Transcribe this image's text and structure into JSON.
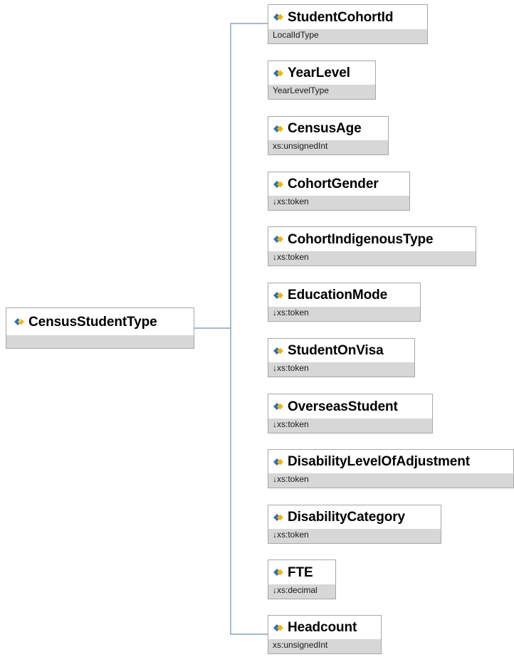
{
  "diagram": {
    "root": {
      "name": "CensusStudentType",
      "type": ""
    },
    "elements": [
      {
        "name": "StudentCohortId",
        "type": "LocalIdType"
      },
      {
        "name": "YearLevel",
        "type": "YearLevelType"
      },
      {
        "name": "CensusAge",
        "type": "xs:unsignedInt"
      },
      {
        "name": "CohortGender",
        "type": "↓xs:token"
      },
      {
        "name": "CohortIndigenousType",
        "type": "↓xs:token"
      },
      {
        "name": "EducationMode",
        "type": "↓xs:token"
      },
      {
        "name": "StudentOnVisa",
        "type": "↓xs:token"
      },
      {
        "name": "OverseasStudent",
        "type": "↓xs:token"
      },
      {
        "name": "DisabilityLevelOfAdjustment",
        "type": "↓xs:token"
      },
      {
        "name": "DisabilityCategory",
        "type": "↓xs:token"
      },
      {
        "name": "FTE",
        "type": "↓xs:decimal"
      },
      {
        "name": "Headcount",
        "type": "xs:unsignedInt"
      }
    ]
  },
  "colors": {
    "connector": "#6d8fb3",
    "node_border": "#a7a7a7",
    "type_band": "#d7d7d7",
    "icon_blue": "#2e6fb5",
    "icon_yellow": "#f2b600"
  },
  "icons": {
    "element": "element-icon"
  }
}
